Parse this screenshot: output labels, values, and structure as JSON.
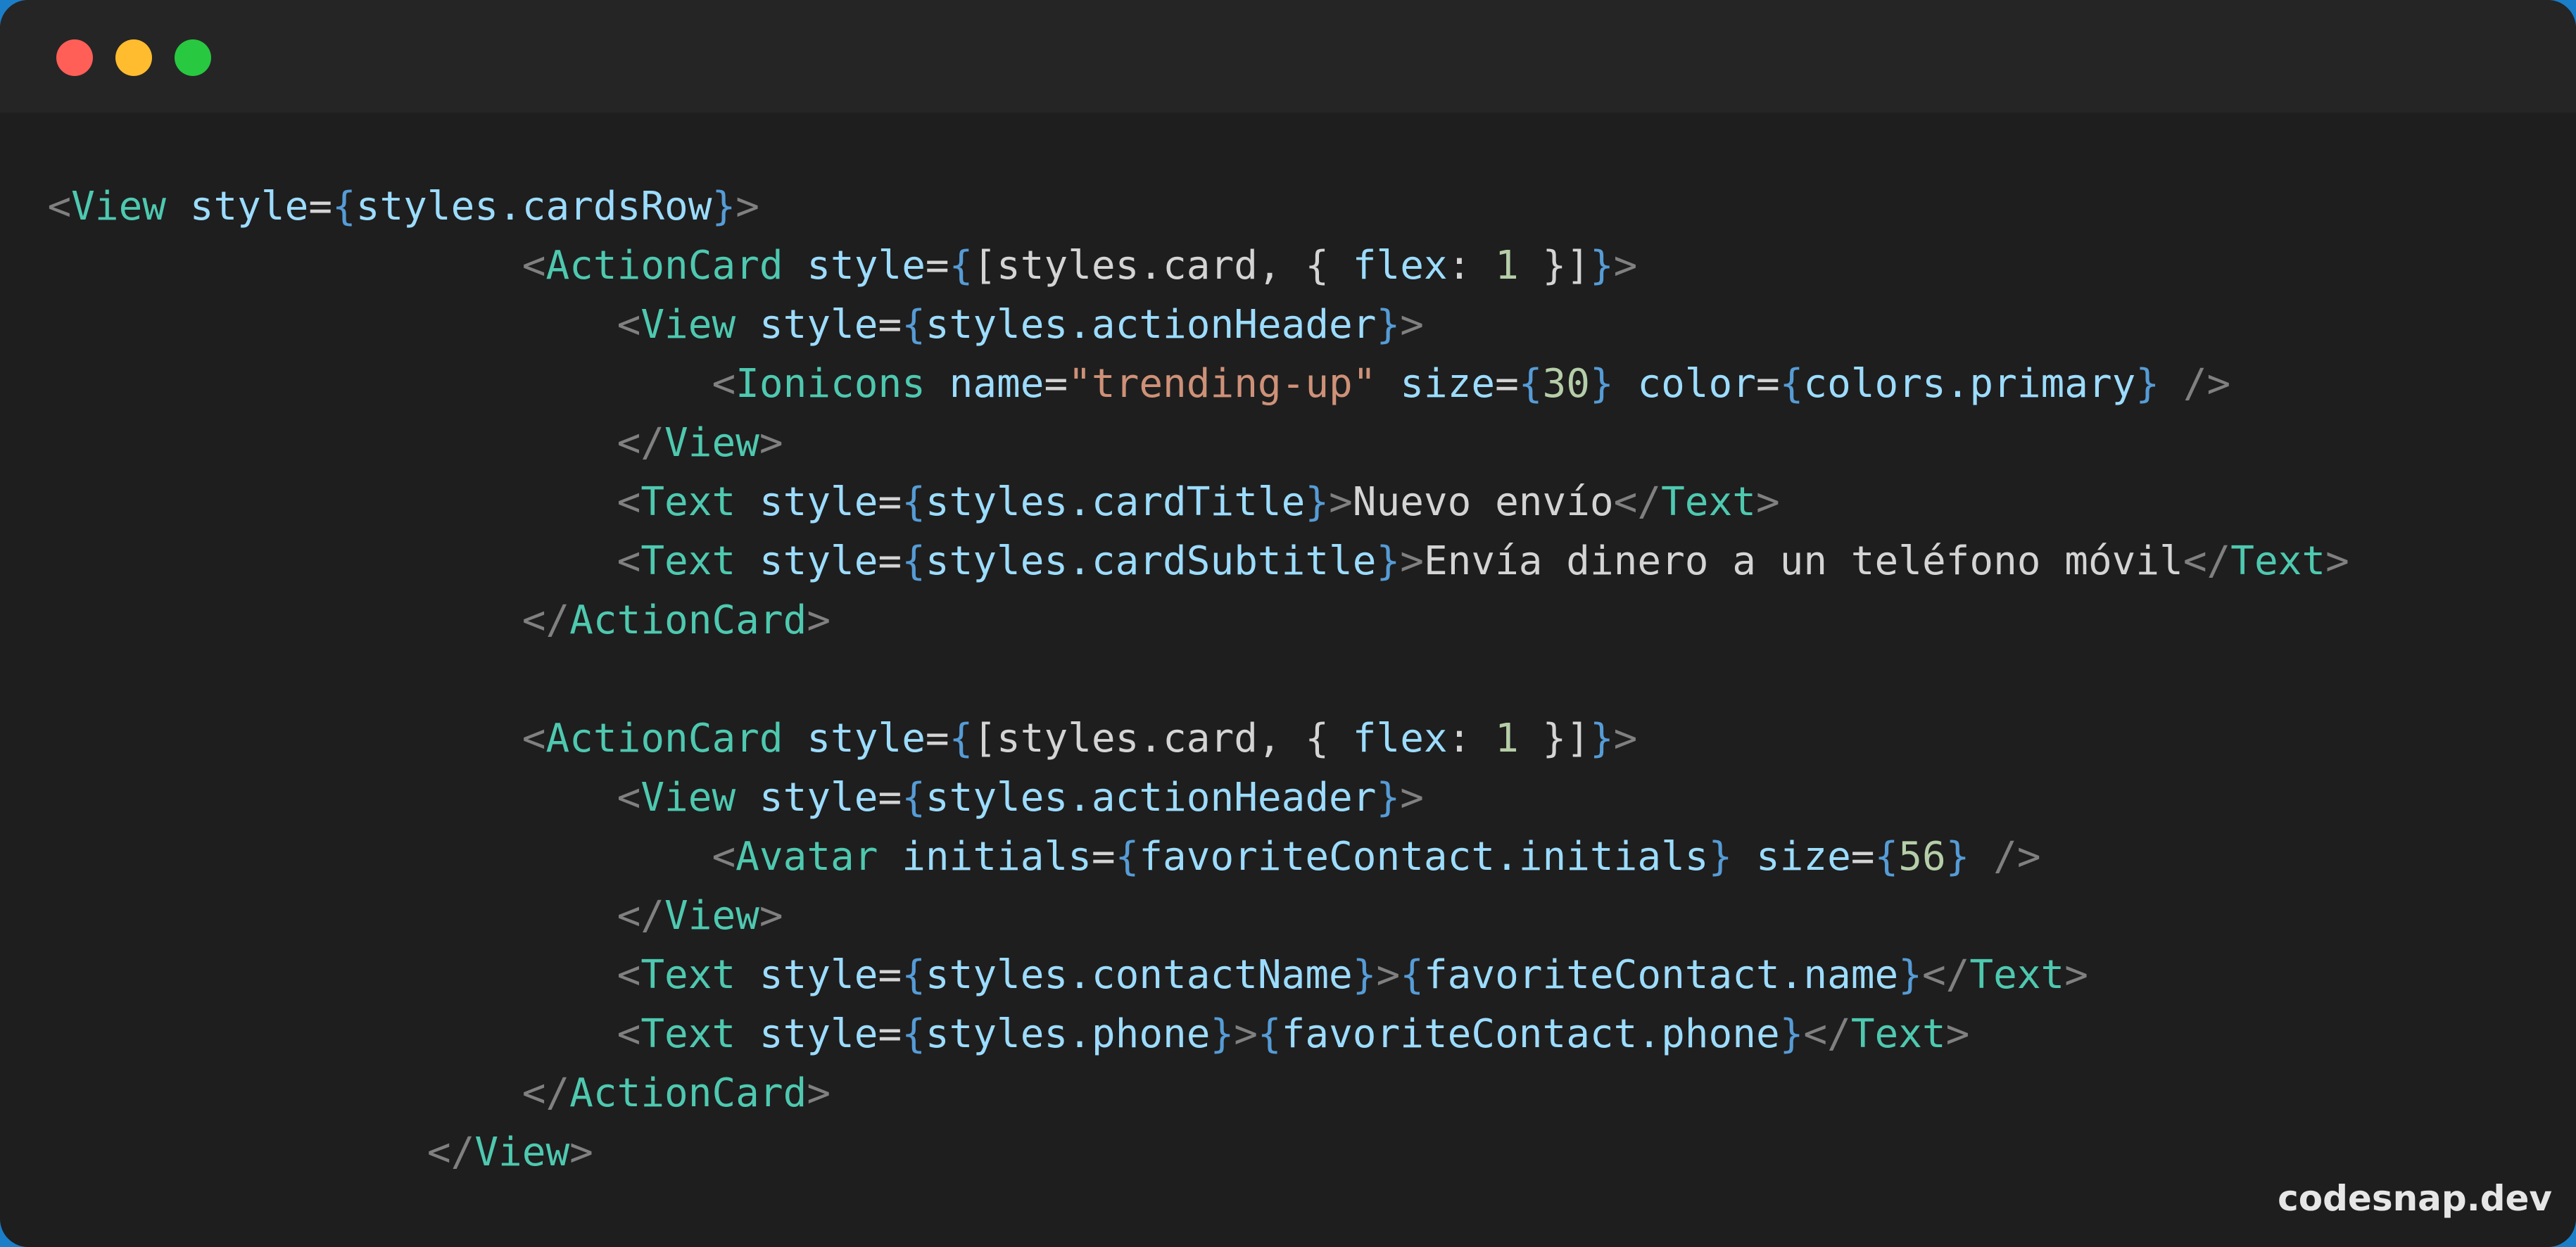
{
  "window": {
    "controls": [
      "close",
      "minimize",
      "maximize"
    ],
    "colors": {
      "close": "#ff5f57",
      "minimize": "#febc2e",
      "maximize": "#28c840",
      "background": "#1e1e1e",
      "titlebar": "#252526"
    }
  },
  "code": {
    "lines": [
      {
        "indent": "",
        "tokens": [
          {
            "t": "<",
            "c": "br"
          },
          {
            "t": "View",
            "c": "tg"
          },
          {
            "t": " ",
            "c": "tx"
          },
          {
            "t": "style",
            "c": "at"
          },
          {
            "t": "=",
            "c": "op"
          },
          {
            "t": "{",
            "c": "cb"
          },
          {
            "t": "styles.cardsRow",
            "c": "id"
          },
          {
            "t": "}",
            "c": "cb"
          },
          {
            "t": ">",
            "c": "br"
          }
        ]
      },
      {
        "indent": "                    ",
        "tokens": [
          {
            "t": "<",
            "c": "br"
          },
          {
            "t": "ActionCard",
            "c": "tg"
          },
          {
            "t": " ",
            "c": "tx"
          },
          {
            "t": "style",
            "c": "at"
          },
          {
            "t": "=",
            "c": "op"
          },
          {
            "t": "{",
            "c": "cb"
          },
          {
            "t": "[styles.card, { ",
            "c": "pc"
          },
          {
            "t": "flex",
            "c": "id"
          },
          {
            "t": ": ",
            "c": "pc"
          },
          {
            "t": "1",
            "c": "nm"
          },
          {
            "t": " }]",
            "c": "pc"
          },
          {
            "t": "}",
            "c": "cb"
          },
          {
            "t": ">",
            "c": "br"
          }
        ]
      },
      {
        "indent": "                        ",
        "tokens": [
          {
            "t": "<",
            "c": "br"
          },
          {
            "t": "View",
            "c": "tg"
          },
          {
            "t": " ",
            "c": "tx"
          },
          {
            "t": "style",
            "c": "at"
          },
          {
            "t": "=",
            "c": "op"
          },
          {
            "t": "{",
            "c": "cb"
          },
          {
            "t": "styles.actionHeader",
            "c": "id"
          },
          {
            "t": "}",
            "c": "cb"
          },
          {
            "t": ">",
            "c": "br"
          }
        ]
      },
      {
        "indent": "                            ",
        "tokens": [
          {
            "t": "<",
            "c": "br"
          },
          {
            "t": "Ionicons",
            "c": "tg"
          },
          {
            "t": " ",
            "c": "tx"
          },
          {
            "t": "name",
            "c": "at"
          },
          {
            "t": "=",
            "c": "op"
          },
          {
            "t": "\"trending-up\"",
            "c": "st"
          },
          {
            "t": " ",
            "c": "tx"
          },
          {
            "t": "size",
            "c": "at"
          },
          {
            "t": "=",
            "c": "op"
          },
          {
            "t": "{",
            "c": "cb"
          },
          {
            "t": "30",
            "c": "nm"
          },
          {
            "t": "}",
            "c": "cb"
          },
          {
            "t": " ",
            "c": "tx"
          },
          {
            "t": "color",
            "c": "at"
          },
          {
            "t": "=",
            "c": "op"
          },
          {
            "t": "{",
            "c": "cb"
          },
          {
            "t": "colors.primary",
            "c": "id"
          },
          {
            "t": "}",
            "c": "cb"
          },
          {
            "t": " />",
            "c": "br"
          }
        ]
      },
      {
        "indent": "                        ",
        "tokens": [
          {
            "t": "</",
            "c": "br"
          },
          {
            "t": "View",
            "c": "tg"
          },
          {
            "t": ">",
            "c": "br"
          }
        ]
      },
      {
        "indent": "                        ",
        "tokens": [
          {
            "t": "<",
            "c": "br"
          },
          {
            "t": "Text",
            "c": "tg"
          },
          {
            "t": " ",
            "c": "tx"
          },
          {
            "t": "style",
            "c": "at"
          },
          {
            "t": "=",
            "c": "op"
          },
          {
            "t": "{",
            "c": "cb"
          },
          {
            "t": "styles.cardTitle",
            "c": "id"
          },
          {
            "t": "}",
            "c": "cb"
          },
          {
            "t": ">",
            "c": "br"
          },
          {
            "t": "Nuevo envío",
            "c": "tx"
          },
          {
            "t": "</",
            "c": "br"
          },
          {
            "t": "Text",
            "c": "tg"
          },
          {
            "t": ">",
            "c": "br"
          }
        ]
      },
      {
        "indent": "                        ",
        "tokens": [
          {
            "t": "<",
            "c": "br"
          },
          {
            "t": "Text",
            "c": "tg"
          },
          {
            "t": " ",
            "c": "tx"
          },
          {
            "t": "style",
            "c": "at"
          },
          {
            "t": "=",
            "c": "op"
          },
          {
            "t": "{",
            "c": "cb"
          },
          {
            "t": "styles.cardSubtitle",
            "c": "id"
          },
          {
            "t": "}",
            "c": "cb"
          },
          {
            "t": ">",
            "c": "br"
          },
          {
            "t": "Envía dinero a un teléfono móvil",
            "c": "tx"
          },
          {
            "t": "</",
            "c": "br"
          },
          {
            "t": "Text",
            "c": "tg"
          },
          {
            "t": ">",
            "c": "br"
          }
        ]
      },
      {
        "indent": "                    ",
        "tokens": [
          {
            "t": "</",
            "c": "br"
          },
          {
            "t": "ActionCard",
            "c": "tg"
          },
          {
            "t": ">",
            "c": "br"
          }
        ]
      },
      {
        "indent": "",
        "tokens": []
      },
      {
        "indent": "                    ",
        "tokens": [
          {
            "t": "<",
            "c": "br"
          },
          {
            "t": "ActionCard",
            "c": "tg"
          },
          {
            "t": " ",
            "c": "tx"
          },
          {
            "t": "style",
            "c": "at"
          },
          {
            "t": "=",
            "c": "op"
          },
          {
            "t": "{",
            "c": "cb"
          },
          {
            "t": "[styles.card, { ",
            "c": "pc"
          },
          {
            "t": "flex",
            "c": "id"
          },
          {
            "t": ": ",
            "c": "pc"
          },
          {
            "t": "1",
            "c": "nm"
          },
          {
            "t": " }]",
            "c": "pc"
          },
          {
            "t": "}",
            "c": "cb"
          },
          {
            "t": ">",
            "c": "br"
          }
        ]
      },
      {
        "indent": "                        ",
        "tokens": [
          {
            "t": "<",
            "c": "br"
          },
          {
            "t": "View",
            "c": "tg"
          },
          {
            "t": " ",
            "c": "tx"
          },
          {
            "t": "style",
            "c": "at"
          },
          {
            "t": "=",
            "c": "op"
          },
          {
            "t": "{",
            "c": "cb"
          },
          {
            "t": "styles.actionHeader",
            "c": "id"
          },
          {
            "t": "}",
            "c": "cb"
          },
          {
            "t": ">",
            "c": "br"
          }
        ]
      },
      {
        "indent": "                            ",
        "tokens": [
          {
            "t": "<",
            "c": "br"
          },
          {
            "t": "Avatar",
            "c": "tg"
          },
          {
            "t": " ",
            "c": "tx"
          },
          {
            "t": "initials",
            "c": "at"
          },
          {
            "t": "=",
            "c": "op"
          },
          {
            "t": "{",
            "c": "cb"
          },
          {
            "t": "favoriteContact.initials",
            "c": "id"
          },
          {
            "t": "}",
            "c": "cb"
          },
          {
            "t": " ",
            "c": "tx"
          },
          {
            "t": "size",
            "c": "at"
          },
          {
            "t": "=",
            "c": "op"
          },
          {
            "t": "{",
            "c": "cb"
          },
          {
            "t": "56",
            "c": "nm"
          },
          {
            "t": "}",
            "c": "cb"
          },
          {
            "t": " />",
            "c": "br"
          }
        ]
      },
      {
        "indent": "                        ",
        "tokens": [
          {
            "t": "</",
            "c": "br"
          },
          {
            "t": "View",
            "c": "tg"
          },
          {
            "t": ">",
            "c": "br"
          }
        ]
      },
      {
        "indent": "                        ",
        "tokens": [
          {
            "t": "<",
            "c": "br"
          },
          {
            "t": "Text",
            "c": "tg"
          },
          {
            "t": " ",
            "c": "tx"
          },
          {
            "t": "style",
            "c": "at"
          },
          {
            "t": "=",
            "c": "op"
          },
          {
            "t": "{",
            "c": "cb"
          },
          {
            "t": "styles.contactName",
            "c": "id"
          },
          {
            "t": "}",
            "c": "cb"
          },
          {
            "t": ">",
            "c": "br"
          },
          {
            "t": "{",
            "c": "cb"
          },
          {
            "t": "favoriteContact.name",
            "c": "id"
          },
          {
            "t": "}",
            "c": "cb"
          },
          {
            "t": "</",
            "c": "br"
          },
          {
            "t": "Text",
            "c": "tg"
          },
          {
            "t": ">",
            "c": "br"
          }
        ]
      },
      {
        "indent": "                        ",
        "tokens": [
          {
            "t": "<",
            "c": "br"
          },
          {
            "t": "Text",
            "c": "tg"
          },
          {
            "t": " ",
            "c": "tx"
          },
          {
            "t": "style",
            "c": "at"
          },
          {
            "t": "=",
            "c": "op"
          },
          {
            "t": "{",
            "c": "cb"
          },
          {
            "t": "styles.phone",
            "c": "id"
          },
          {
            "t": "}",
            "c": "cb"
          },
          {
            "t": ">",
            "c": "br"
          },
          {
            "t": "{",
            "c": "cb"
          },
          {
            "t": "favoriteContact.phone",
            "c": "id"
          },
          {
            "t": "}",
            "c": "cb"
          },
          {
            "t": "</",
            "c": "br"
          },
          {
            "t": "Text",
            "c": "tg"
          },
          {
            "t": ">",
            "c": "br"
          }
        ]
      },
      {
        "indent": "                    ",
        "tokens": [
          {
            "t": "</",
            "c": "br"
          },
          {
            "t": "ActionCard",
            "c": "tg"
          },
          {
            "t": ">",
            "c": "br"
          }
        ]
      },
      {
        "indent": "                ",
        "tokens": [
          {
            "t": "</",
            "c": "br"
          },
          {
            "t": "View",
            "c": "tg"
          },
          {
            "t": ">",
            "c": "br"
          }
        ]
      }
    ]
  },
  "watermark": {
    "text": "codesnap.dev"
  }
}
